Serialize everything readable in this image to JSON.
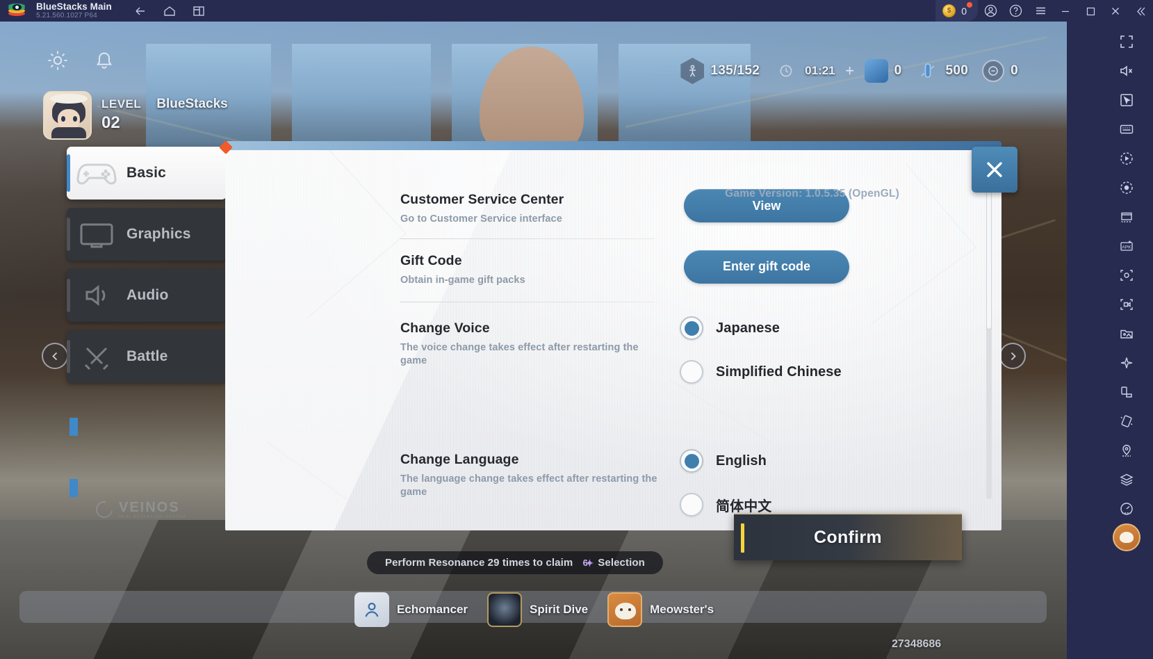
{
  "titlebar": {
    "app_name": "BlueStacks Main",
    "version": "5.21.560.1027  P64",
    "logo_icon": "bluestacks-logo-icon",
    "nav": [
      {
        "name": "back-icon",
        "label": "Back"
      },
      {
        "name": "home-icon",
        "label": "Home"
      },
      {
        "name": "instance-manager-icon",
        "label": "Multi-instance"
      }
    ],
    "coin_value": "0",
    "coin_icon": "coin-icon",
    "notification_dot": true,
    "right_icons": [
      {
        "name": "account-icon",
        "label": "Account"
      },
      {
        "name": "help-icon",
        "label": "Help"
      },
      {
        "name": "menu-icon",
        "label": "Menu"
      }
    ],
    "window_controls": [
      {
        "name": "minimize-button",
        "label": "Minimize"
      },
      {
        "name": "maximize-button",
        "label": "Maximize"
      },
      {
        "name": "close-button",
        "label": "Close"
      },
      {
        "name": "collapse-toolbar-button",
        "label": "Collapse"
      }
    ]
  },
  "game_hud": {
    "gear_icon": "settings-gear-icon",
    "bell_icon": "notification-bell-icon",
    "player": {
      "level_label": "LEVEL",
      "level_value": "02",
      "name": "BlueStacks",
      "avatar_icon": "player-avatar"
    },
    "stamina": {
      "icon": "stamina-icon",
      "value": "135/152"
    },
    "timer": {
      "icon": "clock-icon",
      "value": "01:21"
    },
    "add_icon": "plus-icon",
    "currency_primary": {
      "icon": "blue-crystal-icon",
      "value": "0"
    },
    "currency_secondary": {
      "icon": "vial-icon",
      "value": "500"
    },
    "currency_tertiary": {
      "icon": "coin-medal-icon",
      "value": "0"
    },
    "arrow_left_icon": "page-left-arrow-icon",
    "arrow_right_icon": "page-right-arrow-icon",
    "banner_text": "Perform Resonance 29 times to claim",
    "banner_count": "6",
    "banner_suffix": "Selection",
    "bottom_nav": [
      {
        "label": "Echomancer",
        "icon": "echomancer-icon"
      },
      {
        "label": "Spirit Dive",
        "icon": "spirit-dive-icon"
      },
      {
        "label": "Meowster's",
        "icon": "meowster-icon"
      }
    ],
    "uid": "27348686"
  },
  "settings_dialog": {
    "game_version": "Game Version: 1.0.5.35 (OpenGL)",
    "close_icon": "close-icon",
    "confirm_label": "Confirm",
    "sidebar": [
      {
        "label": "Basic",
        "icon": "gamepad-icon",
        "active": true,
        "badge": true
      },
      {
        "label": "Graphics",
        "icon": "graphics-icon",
        "active": false,
        "badge": false
      },
      {
        "label": "Audio",
        "icon": "audio-icon",
        "active": false,
        "badge": false
      },
      {
        "label": "Battle",
        "icon": "battle-icon",
        "active": false,
        "badge": false
      }
    ],
    "brand": {
      "name": "VEINOS",
      "tagline": "REAL ADVENTURE SYSTEM"
    },
    "rows": [
      {
        "title": "Customer Service Center",
        "desc": "Go to Customer Service interface",
        "control": "button",
        "button_label": "View"
      },
      {
        "title": "Gift Code",
        "desc": "Obtain in-game gift packs",
        "control": "button",
        "button_label": "Enter gift code"
      },
      {
        "title": "Change Voice",
        "desc": "The voice change takes effect after restarting the game",
        "control": "radio",
        "options": [
          {
            "label": "Japanese",
            "checked": true
          },
          {
            "label": "Simplified Chinese",
            "checked": false
          }
        ]
      },
      {
        "title": "Change Language",
        "desc": "The language change takes effect after restarting the game",
        "control": "radio",
        "options": [
          {
            "label": "English",
            "checked": true
          },
          {
            "label": "简体中文",
            "checked": false
          }
        ]
      }
    ]
  },
  "right_toolbar": [
    {
      "name": "fullscreen-icon",
      "label": "Full screen"
    },
    {
      "name": "mute-icon",
      "label": "Mute"
    },
    {
      "name": "cursor-icon",
      "label": "Pointer"
    },
    {
      "name": "keyboard-controls-icon",
      "label": "Game controls"
    },
    {
      "name": "macro-play-icon",
      "label": "Macro"
    },
    {
      "name": "record-icon",
      "label": "Record"
    },
    {
      "name": "multi-instance-icon",
      "label": "Multi-instance"
    },
    {
      "name": "install-apk-icon",
      "label": "Install APK"
    },
    {
      "name": "screenshot-icon",
      "label": "Screenshot"
    },
    {
      "name": "video-record-icon",
      "label": "Record screen"
    },
    {
      "name": "media-manager-icon",
      "label": "Media manager"
    },
    {
      "name": "eco-mode-icon",
      "label": "Eco mode"
    },
    {
      "name": "rotate-icon",
      "label": "Rotate"
    },
    {
      "name": "shake-icon",
      "label": "Shake"
    },
    {
      "name": "location-icon",
      "label": "Location"
    },
    {
      "name": "layers-icon",
      "label": "Layers"
    },
    {
      "name": "performance-icon",
      "label": "Performance"
    }
  ]
}
